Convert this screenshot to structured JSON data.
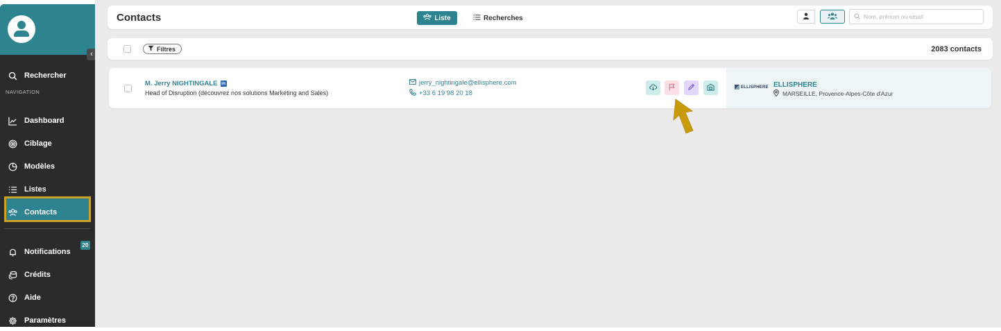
{
  "sidebar": {
    "collapse_icon": "chevron-left",
    "search_label": "Rechercher",
    "section_label": "NAVIGATION",
    "items": [
      {
        "label": "Dashboard",
        "icon": "chart-line-icon"
      },
      {
        "label": "Ciblage",
        "icon": "target-icon"
      },
      {
        "label": "Modèles",
        "icon": "pie-icon"
      },
      {
        "label": "Listes",
        "icon": "list-icon"
      },
      {
        "label": "Contacts",
        "icon": "users-icon",
        "active": true
      }
    ],
    "bottom_items": [
      {
        "label": "Notifications",
        "icon": "bell-icon",
        "badge": "20"
      },
      {
        "label": "Crédits",
        "icon": "coins-icon"
      },
      {
        "label": "Aide",
        "icon": "help-icon"
      },
      {
        "label": "Paramètres",
        "icon": "gear-icon"
      }
    ]
  },
  "header": {
    "title": "Contacts",
    "tabs": [
      {
        "label": "Liste",
        "active": true
      },
      {
        "label": "Recherches",
        "active": false
      }
    ],
    "search_placeholder": "Nom, prénom ou email"
  },
  "filterbar": {
    "filters_label": "Filtres",
    "count_label": "2083 contacts"
  },
  "contacts": [
    {
      "name": "M. Jerry NIGHTINGALE",
      "linkedin_badge": "in",
      "job": "Head of Disruption (découvrez nos solutions Marketing and Sales)",
      "email": "jerry_nightingale@ellisphere.com",
      "phone": "+33 6 19 98 20 18",
      "company_logo_text": "ELLISPHERE",
      "company": "ELLISPHERE",
      "location": "MARSEILLE, Provence-Alpes-Côte d'Azur"
    }
  ],
  "colors": {
    "accent": "#2e8390",
    "sidebar_bg": "#2b2b2b",
    "highlight": "#c9a227",
    "action_teal": "#cdecea",
    "action_pink": "#fbe0e6",
    "action_purple": "#e1d6fb"
  }
}
